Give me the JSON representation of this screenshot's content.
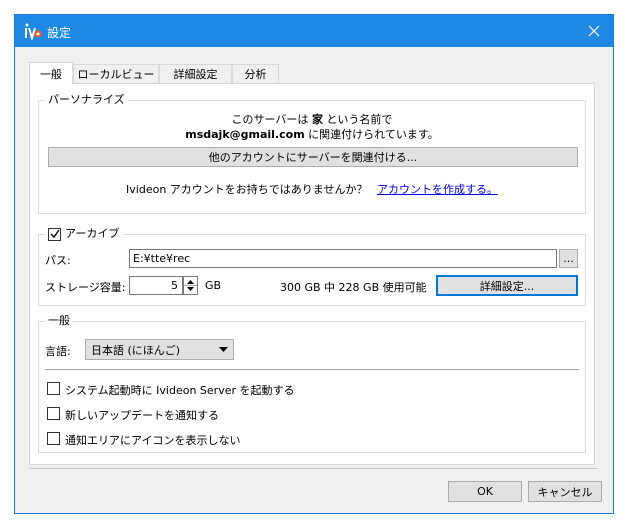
{
  "window": {
    "title": "設定",
    "close_label": "✕"
  },
  "tabs": [
    {
      "label": "一般",
      "active": true
    },
    {
      "label": "ローカルビュー"
    },
    {
      "label": "詳細設定"
    },
    {
      "label": "分析"
    }
  ],
  "personalize": {
    "legend": "パーソナライズ",
    "line1_pre": "このサーバーは ",
    "line1_name": "家",
    "line1_post": " という名前で",
    "line2_email": "msdajk@gmail.com",
    "line2_post": " に関連付けられています。",
    "link_other_button": "他のアカウントにサーバーを関連付ける...",
    "no_account_text": "Ivideon アカウントをお持ちではありませんか？",
    "create_account_link": "アカウントを作成する。"
  },
  "archive": {
    "legend": "アーカイブ",
    "checked": true,
    "path_label": "パス:",
    "path_value": "E:¥tte¥rec",
    "browse_label": "...",
    "storage_label": "ストレージ容量:",
    "storage_value": "5",
    "storage_unit": "GB",
    "usage_text": "300 GB 中 228 GB 使用可能",
    "detail_button": "詳細設定..."
  },
  "general": {
    "legend": "一般",
    "language_label": "言語:",
    "language_value": "日本語 (にほんご)",
    "options": [
      {
        "label": "システム起動時に Ivideon Server を起動する",
        "checked": false
      },
      {
        "label": "新しいアップデートを通知する",
        "checked": false
      },
      {
        "label": "通知エリアにアイコンを表示しない",
        "checked": false
      }
    ]
  },
  "footer": {
    "ok_label": "OK",
    "cancel_label": "キャンセル"
  },
  "colors": {
    "titlebar": "#1e88e5",
    "link": "#0000ee",
    "focus": "#0078d7"
  }
}
